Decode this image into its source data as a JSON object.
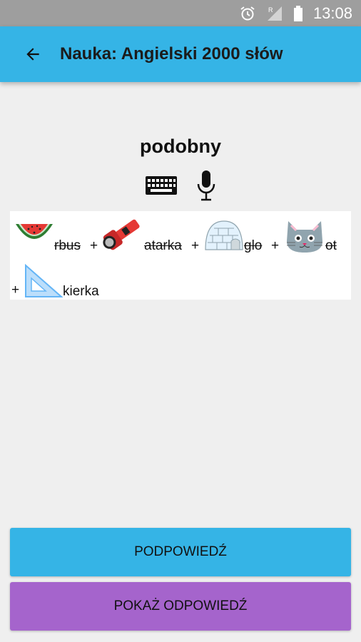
{
  "status_bar": {
    "time": "13:08",
    "icons": [
      "alarm-icon",
      "signal-icon",
      "battery-icon"
    ]
  },
  "app_bar": {
    "back_icon": "arrow-back-icon",
    "title": "Nauka: Angielski 2000 słów"
  },
  "word": "podobny",
  "tools": [
    "keyboard-icon",
    "microphone-icon"
  ],
  "rebus": {
    "parts": [
      {
        "picture": "watermelon",
        "text": "rbus",
        "struck_letters": "rbus"
      },
      {
        "picture": "flashlight",
        "text": "atarka",
        "struck_letters": "atarka"
      },
      {
        "picture": "igloo",
        "text": "glo",
        "struck_letters": "glo"
      },
      {
        "picture": "cat",
        "text": "ot",
        "struck_letters": "ot"
      },
      {
        "picture": "set-square",
        "text": "kierka",
        "struck_letters": ""
      }
    ],
    "separator": "+"
  },
  "buttons": {
    "hint": "PODPOWIEDŹ",
    "answer": "POKAŻ ODPOWIEDŹ"
  },
  "colors": {
    "primary": "#35b4e6",
    "accent": "#a564cc",
    "background": "#efefef",
    "status_bar": "#9e9e9e"
  }
}
